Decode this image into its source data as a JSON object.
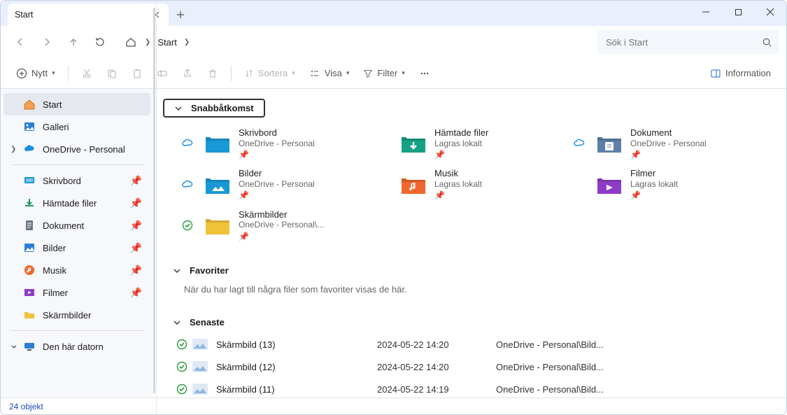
{
  "window": {
    "tab_title": "Start",
    "new_tab": "+"
  },
  "breadcrumb": {
    "location": "Start"
  },
  "search": {
    "placeholder": "Sök i Start"
  },
  "toolbar": {
    "new_label": "Nytt",
    "sort_label": "Sortera",
    "view_label": "Visa",
    "filter_label": "Filter",
    "details_label": "Information"
  },
  "sidebar": {
    "top": [
      {
        "label": "Start",
        "icon": "home",
        "selected": true
      },
      {
        "label": "Galleri",
        "icon": "gallery"
      },
      {
        "label": "OneDrive - Personal",
        "icon": "onedrive",
        "expandable": true
      }
    ],
    "pinned": [
      {
        "label": "Skrivbord",
        "icon": "desktop"
      },
      {
        "label": "Hämtade filer",
        "icon": "download"
      },
      {
        "label": "Dokument",
        "icon": "documents"
      },
      {
        "label": "Bilder",
        "icon": "pictures"
      },
      {
        "label": "Musik",
        "icon": "music"
      },
      {
        "label": "Filmer",
        "icon": "videos"
      },
      {
        "label": "Skärmbilder",
        "icon": "folder"
      }
    ],
    "bottom": [
      {
        "label": "Den här datorn",
        "icon": "pc",
        "expandable": true
      }
    ]
  },
  "sections": {
    "quick_access_title": "Snabbåtkomst",
    "favorites_title": "Favoriter",
    "favorites_empty": "När du har lagt till några filer som favoriter visas de här.",
    "recent_title": "Senaste"
  },
  "quick_access": [
    {
      "name": "Skrivbord",
      "sub": "OneDrive - Personal",
      "status": "cloud",
      "color": "#1998d6"
    },
    {
      "name": "Hämtade filer",
      "sub": "Lagras lokalt",
      "status": "",
      "color": "#16a085"
    },
    {
      "name": "Dokument",
      "sub": "OneDrive - Personal",
      "status": "cloud",
      "color": "#5e7fa8"
    },
    {
      "name": "Bilder",
      "sub": "OneDrive - Personal",
      "status": "cloud",
      "color": "#1998d6"
    },
    {
      "name": "Musik",
      "sub": "Lagras lokalt",
      "status": "",
      "color": "#f0672e"
    },
    {
      "name": "Filmer",
      "sub": "Lagras lokalt",
      "status": "",
      "color": "#8e3cc7"
    },
    {
      "name": "Skärmbilder",
      "sub": "OneDrive - Personal\\...",
      "status": "synced",
      "color": "#f0c23a"
    }
  ],
  "recent": [
    {
      "name": "Skärmbild (13)",
      "date": "2024-05-22 14:20",
      "location": "OneDrive - Personal\\Bild..."
    },
    {
      "name": "Skärmbild (12)",
      "date": "2024-05-22 14:20",
      "location": "OneDrive - Personal\\Bild..."
    },
    {
      "name": "Skärmbild (11)",
      "date": "2024-05-22 14:19",
      "location": "OneDrive - Personal\\Bild..."
    }
  ],
  "status": {
    "items": "24 objekt"
  }
}
